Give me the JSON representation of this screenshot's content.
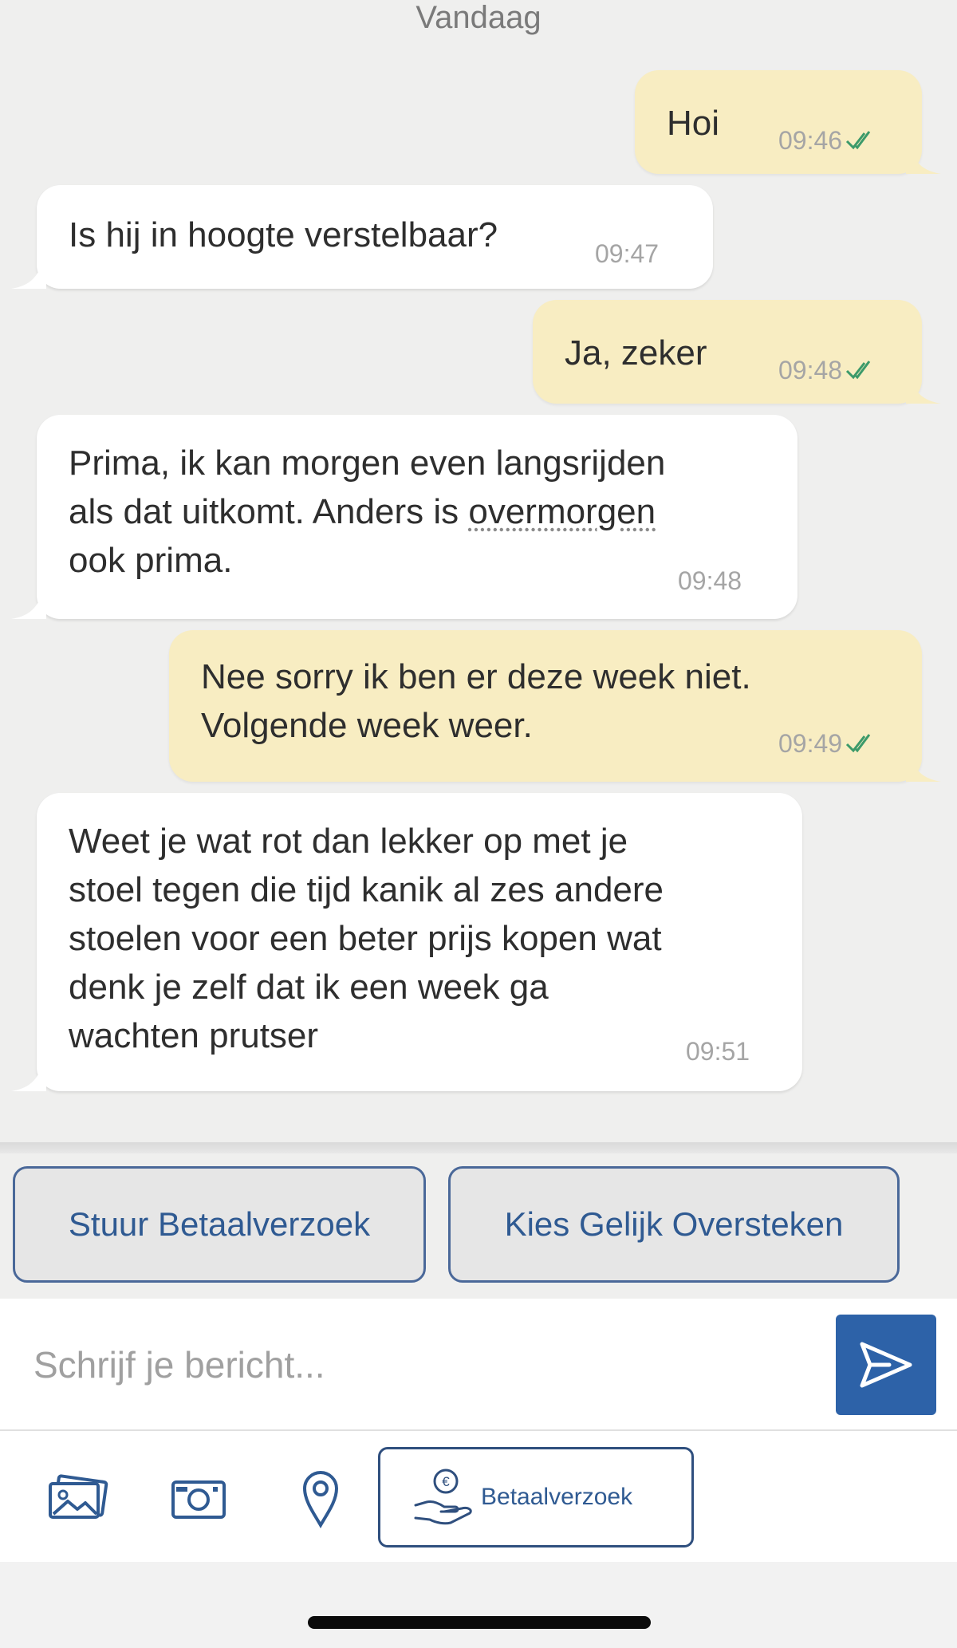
{
  "chat": {
    "date_label": "Vandaag",
    "messages": [
      {
        "direction": "out",
        "text": "Hoi",
        "time": "09:46",
        "read": true
      },
      {
        "direction": "in",
        "text": "Is hij in hoogte verstelbaar?",
        "time": "09:47"
      },
      {
        "direction": "out",
        "text": "Ja, zeker",
        "time": "09:48",
        "read": true
      },
      {
        "direction": "in",
        "text_before": "Prima, ik kan morgen even langsrijden\nals dat uitkomt. Anders is ",
        "text_link": "overmorgen",
        "text_after": "\nook prima.",
        "time": "09:48"
      },
      {
        "direction": "out",
        "text": "Nee sorry ik ben er deze week niet.\nVolgende week weer.",
        "time": "09:49",
        "read": true
      },
      {
        "direction": "in",
        "text": "Weet je wat rot dan lekker op met je\nstoel tegen die tijd kanik al zes andere\nstoelen voor een beter prijs kopen wat\ndenk je zelf dat ik een week ga\nwachten prutser",
        "time": "09:51"
      }
    ]
  },
  "quick_actions": {
    "payment_request": "Stuur Betaalverzoek",
    "fair_exchange": "Kies Gelijk Oversteken"
  },
  "composer": {
    "placeholder": "Schrijf je bericht...",
    "value": ""
  },
  "toolbar": {
    "payment_button_label": "Betaalverzoek",
    "icons": [
      "gallery-icon",
      "camera-icon",
      "location-icon",
      "euro-hand-icon"
    ]
  },
  "colors": {
    "incoming_bubble": "#ffffff",
    "outgoing_bubble": "#f8edc2",
    "accent_blue": "#2d62a8",
    "read_check": "#3c9a6a",
    "background": "#efefee"
  }
}
